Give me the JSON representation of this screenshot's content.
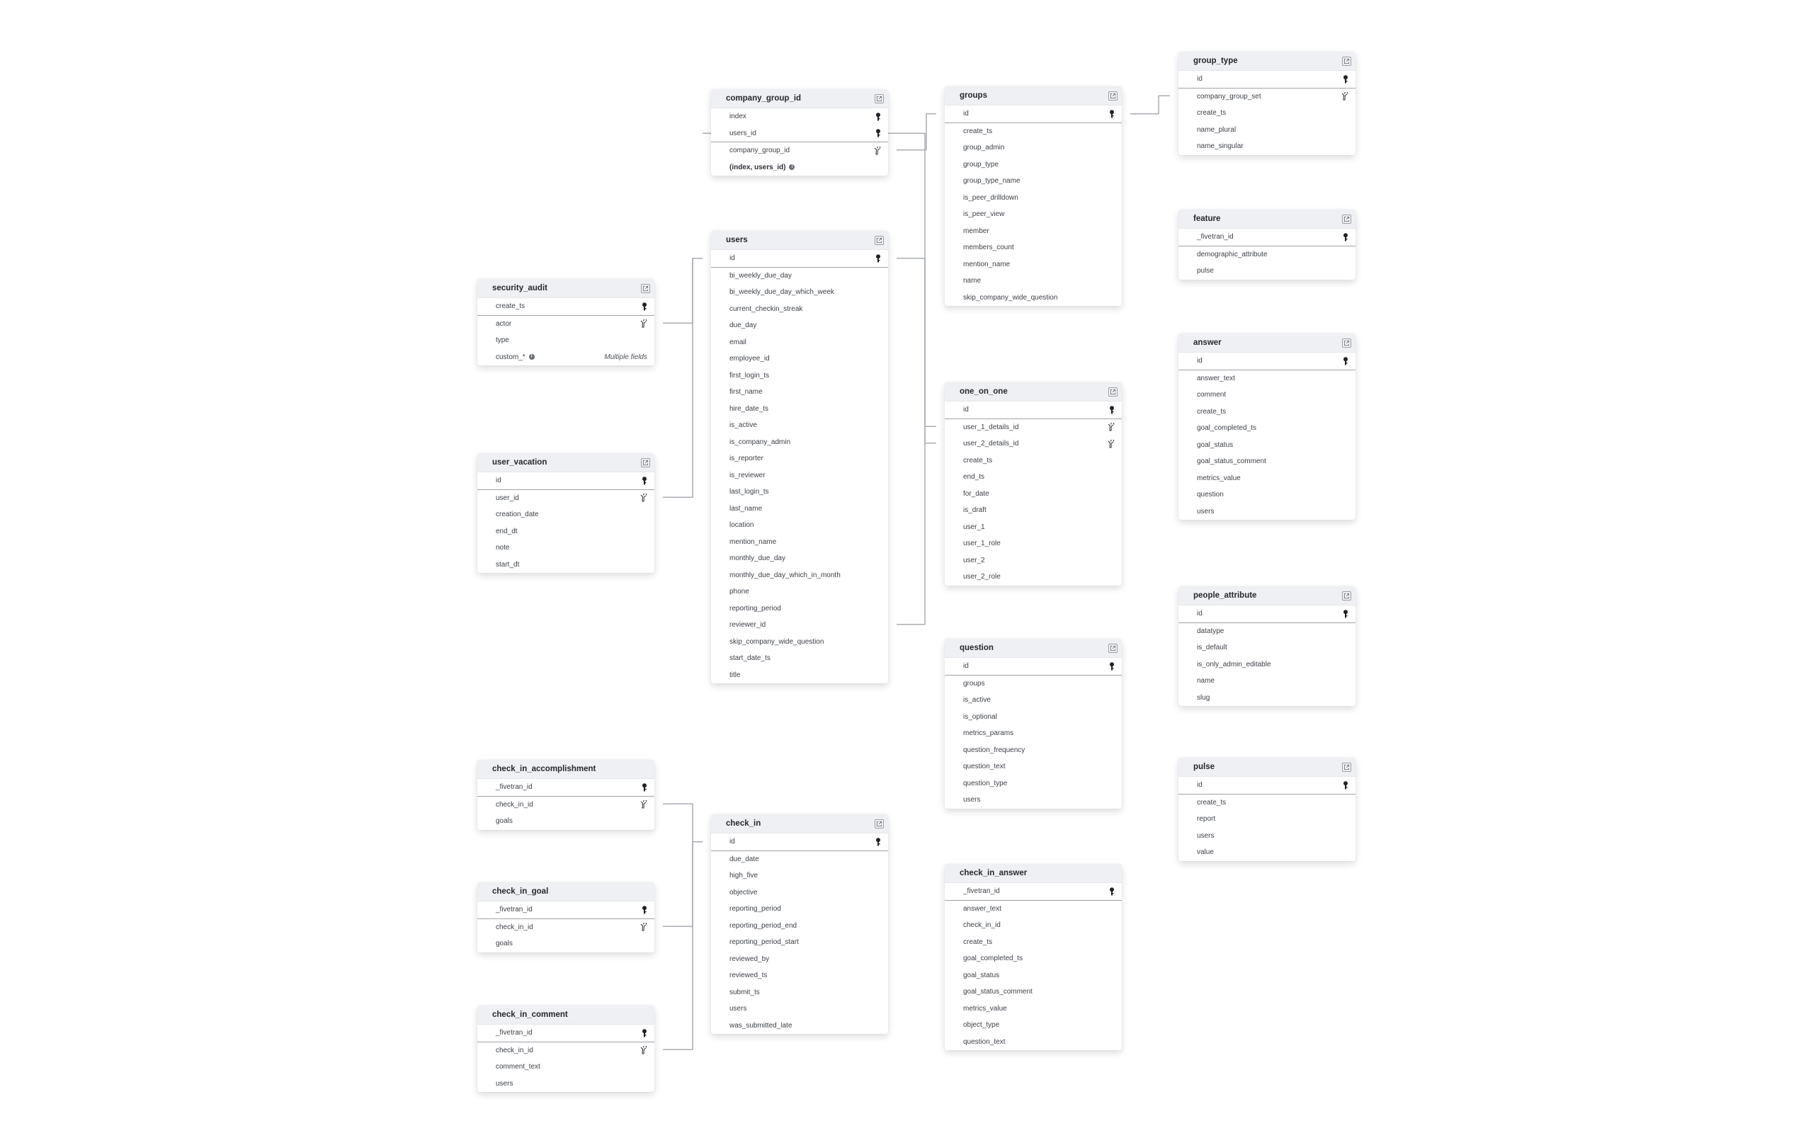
{
  "diagram": {
    "tables": [
      {
        "id": "security_audit",
        "name": "security_audit",
        "has_link": true,
        "columns": [
          {
            "name": "create_ts",
            "key": "pk"
          },
          {
            "name": "actor",
            "key": "fk"
          },
          {
            "name": "type"
          },
          {
            "name": "custom_*",
            "info": true,
            "note": "Multiple fields"
          }
        ]
      },
      {
        "id": "user_vacation",
        "name": "user_vacation",
        "has_link": true,
        "columns": [
          {
            "name": "id",
            "key": "pk"
          },
          {
            "name": "user_id",
            "key": "fk"
          },
          {
            "name": "creation_date"
          },
          {
            "name": "end_dt"
          },
          {
            "name": "note"
          },
          {
            "name": "start_dt"
          }
        ]
      },
      {
        "id": "check_in_accomplishment",
        "name": "check_in_accomplishment",
        "has_link": false,
        "columns": [
          {
            "name": "_fivetran_id",
            "key": "pk"
          },
          {
            "name": "check_in_id",
            "key": "fk"
          },
          {
            "name": "goals"
          }
        ]
      },
      {
        "id": "check_in_goal",
        "name": "check_in_goal",
        "has_link": false,
        "columns": [
          {
            "name": "_fivetran_id",
            "key": "pk"
          },
          {
            "name": "check_in_id",
            "key": "fk"
          },
          {
            "name": "goals"
          }
        ]
      },
      {
        "id": "check_in_comment",
        "name": "check_in_comment",
        "has_link": false,
        "columns": [
          {
            "name": "_fivetran_id",
            "key": "pk"
          },
          {
            "name": "check_in_id",
            "key": "fk"
          },
          {
            "name": "comment_text"
          },
          {
            "name": "users"
          }
        ]
      },
      {
        "id": "company_group_id",
        "name": "company_group_id",
        "has_link": true,
        "columns": [
          {
            "name": "index",
            "key": "pk"
          },
          {
            "name": "users_id",
            "key": "pk"
          },
          {
            "name": "company_group_id",
            "key": "fk"
          },
          {
            "name": "(index, users_id)",
            "bold": true,
            "info": true
          }
        ]
      },
      {
        "id": "users",
        "name": "users",
        "has_link": true,
        "columns": [
          {
            "name": "id",
            "key": "pk"
          },
          {
            "name": "bi_weekly_due_day"
          },
          {
            "name": "bi_weekly_due_day_which_week"
          },
          {
            "name": "current_checkin_streak"
          },
          {
            "name": "due_day"
          },
          {
            "name": "email"
          },
          {
            "name": "employee_id"
          },
          {
            "name": "first_login_ts"
          },
          {
            "name": "first_name"
          },
          {
            "name": "hire_date_ts"
          },
          {
            "name": "is_active"
          },
          {
            "name": "is_company_admin"
          },
          {
            "name": "is_reporter"
          },
          {
            "name": "is_reviewer"
          },
          {
            "name": "last_login_ts"
          },
          {
            "name": "last_name"
          },
          {
            "name": "location"
          },
          {
            "name": "mention_name"
          },
          {
            "name": "monthly_due_day"
          },
          {
            "name": "monthly_due_day_which_in_month"
          },
          {
            "name": "phone"
          },
          {
            "name": "reporting_period"
          },
          {
            "name": "reviewer_id"
          },
          {
            "name": "skip_company_wide_question"
          },
          {
            "name": "start_date_ts"
          },
          {
            "name": "title"
          }
        ]
      },
      {
        "id": "check_in",
        "name": "check_in",
        "has_link": true,
        "columns": [
          {
            "name": "id",
            "key": "pk"
          },
          {
            "name": "due_date"
          },
          {
            "name": "high_five"
          },
          {
            "name": "objective"
          },
          {
            "name": "reporting_period"
          },
          {
            "name": "reporting_period_end"
          },
          {
            "name": "reporting_period_start"
          },
          {
            "name": "reviewed_by"
          },
          {
            "name": "reviewed_ts"
          },
          {
            "name": "submit_ts"
          },
          {
            "name": "users"
          },
          {
            "name": "was_submitted_late"
          }
        ]
      },
      {
        "id": "groups",
        "name": "groups",
        "has_link": true,
        "columns": [
          {
            "name": "id",
            "key": "pk"
          },
          {
            "name": "create_ts"
          },
          {
            "name": "group_admin"
          },
          {
            "name": "group_type"
          },
          {
            "name": "group_type_name"
          },
          {
            "name": "is_peer_drilldown"
          },
          {
            "name": "is_peer_view"
          },
          {
            "name": "member"
          },
          {
            "name": "members_count"
          },
          {
            "name": "mention_name"
          },
          {
            "name": "name"
          },
          {
            "name": "skip_company_wide_question"
          }
        ]
      },
      {
        "id": "one_on_one",
        "name": "one_on_one",
        "has_link": true,
        "columns": [
          {
            "name": "id",
            "key": "pk"
          },
          {
            "name": "user_1_details_id",
            "key": "fk"
          },
          {
            "name": "user_2_details_id",
            "key": "fk"
          },
          {
            "name": "create_ts"
          },
          {
            "name": "end_ts"
          },
          {
            "name": "for_date"
          },
          {
            "name": "is_draft"
          },
          {
            "name": "user_1"
          },
          {
            "name": "user_1_role"
          },
          {
            "name": "user_2"
          },
          {
            "name": "user_2_role"
          }
        ]
      },
      {
        "id": "question",
        "name": "question",
        "has_link": true,
        "columns": [
          {
            "name": "id",
            "key": "pk"
          },
          {
            "name": "groups"
          },
          {
            "name": "is_active"
          },
          {
            "name": "is_optional"
          },
          {
            "name": "metrics_params"
          },
          {
            "name": "question_frequency"
          },
          {
            "name": "question_text"
          },
          {
            "name": "question_type"
          },
          {
            "name": "users"
          }
        ]
      },
      {
        "id": "check_in_answer",
        "name": "check_in_answer",
        "has_link": false,
        "columns": [
          {
            "name": "_fivetran_id",
            "key": "pk"
          },
          {
            "name": "answer_text"
          },
          {
            "name": "check_in_id"
          },
          {
            "name": "create_ts"
          },
          {
            "name": "goal_completed_ts"
          },
          {
            "name": "goal_status"
          },
          {
            "name": "goal_status_comment"
          },
          {
            "name": "metrics_value"
          },
          {
            "name": "object_type"
          },
          {
            "name": "question_text"
          }
        ]
      },
      {
        "id": "group_type",
        "name": "group_type",
        "has_link": true,
        "columns": [
          {
            "name": "id",
            "key": "pk"
          },
          {
            "name": "company_group_set",
            "key": "fk"
          },
          {
            "name": "create_ts"
          },
          {
            "name": "name_plural"
          },
          {
            "name": "name_singular"
          }
        ]
      },
      {
        "id": "feature",
        "name": "feature",
        "has_link": true,
        "columns": [
          {
            "name": "_fivetran_id",
            "key": "pk"
          },
          {
            "name": "demographic_attribute"
          },
          {
            "name": "pulse"
          }
        ]
      },
      {
        "id": "answer",
        "name": "answer",
        "has_link": true,
        "columns": [
          {
            "name": "id",
            "key": "pk"
          },
          {
            "name": "answer_text"
          },
          {
            "name": "comment"
          },
          {
            "name": "create_ts"
          },
          {
            "name": "goal_completed_ts"
          },
          {
            "name": "goal_status"
          },
          {
            "name": "goal_status_comment"
          },
          {
            "name": "metrics_value"
          },
          {
            "name": "question"
          },
          {
            "name": "users"
          }
        ]
      },
      {
        "id": "people_attribute",
        "name": "people_attribute",
        "has_link": true,
        "columns": [
          {
            "name": "id",
            "key": "pk"
          },
          {
            "name": "datatype"
          },
          {
            "name": "is_default"
          },
          {
            "name": "is_only_admin_editable"
          },
          {
            "name": "name"
          },
          {
            "name": "slug"
          }
        ]
      },
      {
        "id": "pulse",
        "name": "pulse",
        "has_link": true,
        "columns": [
          {
            "name": "id",
            "key": "pk"
          },
          {
            "name": "create_ts"
          },
          {
            "name": "report"
          },
          {
            "name": "users"
          },
          {
            "name": "value"
          }
        ]
      }
    ],
    "relationships": [
      {
        "from": "security_audit.actor",
        "to": "users.id"
      },
      {
        "from": "user_vacation.user_id",
        "to": "users.id"
      },
      {
        "from": "company_group_id.company_group_id",
        "to": "groups.id"
      },
      {
        "from": "one_on_one.user_1_details_id",
        "to": "users.id"
      },
      {
        "from": "one_on_one.user_2_details_id",
        "to": "users.id"
      },
      {
        "from": "users.reviewer_id",
        "to": "users.id"
      },
      {
        "from": "group_type.company_group_set",
        "to": "groups.id"
      },
      {
        "from": "check_in_accomplishment.check_in_id",
        "to": "check_in.id"
      },
      {
        "from": "check_in_goal.check_in_id",
        "to": "check_in.id"
      },
      {
        "from": "check_in_comment.check_in_id",
        "to": "check_in.id"
      },
      {
        "from": "company_group_id.users_id",
        "to": "users.id"
      }
    ]
  }
}
